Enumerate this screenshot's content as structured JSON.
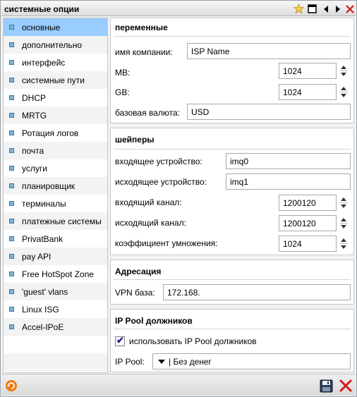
{
  "window": {
    "title": "системные опции"
  },
  "sidebar": {
    "items": [
      {
        "label": "основные"
      },
      {
        "label": "дополнительно"
      },
      {
        "label": "интерфейс"
      },
      {
        "label": "системные пути"
      },
      {
        "label": "DHCP"
      },
      {
        "label": "MRTG"
      },
      {
        "label": "Ротация логов"
      },
      {
        "label": "почта"
      },
      {
        "label": "услуги"
      },
      {
        "label": "планировщик"
      },
      {
        "label": "терминалы"
      },
      {
        "label": "платежные системы"
      },
      {
        "label": "PrivatBank"
      },
      {
        "label": "pay API"
      },
      {
        "label": "Free HotSpot Zone"
      },
      {
        "label": "'guest' vlans"
      },
      {
        "label": "Linux ISG"
      },
      {
        "label": "Accel-IPoE"
      }
    ],
    "selected": "основные"
  },
  "variables": {
    "heading": "переменные",
    "company_label": "имя компании:",
    "company_value": "ISP Name",
    "mb_label": "MB:",
    "mb_value": "1024",
    "gb_label": "GB:",
    "gb_value": "1024",
    "currency_label": "базовая валюта:",
    "currency_value": "USD"
  },
  "shapers": {
    "heading": "шейперы",
    "in_dev_label": "входящее устройство:",
    "in_dev_value": "imq0",
    "out_dev_label": "исходящее устройство:",
    "out_dev_value": "imq1",
    "in_chan_label": "входящий канал:",
    "in_chan_value": "1200120",
    "out_chan_label": "исходящий канал:",
    "out_chan_value": "1200120",
    "mult_label": "коэффициент умножения:",
    "mult_value": "1024"
  },
  "addressing": {
    "heading": "Адресация",
    "vpn_label": "VPN база:",
    "vpn_value": "172.168."
  },
  "ippool": {
    "heading": "IP Pool должников",
    "use_label": "использовать IP Pool должников",
    "use_checked": true,
    "pool_label": "IP Pool:",
    "pool_value": "| Без денег"
  },
  "icons": {
    "title_star": "star-icon",
    "title_window": "window-icon",
    "title_prev": "arrow-left-icon",
    "title_next": "arrow-right-icon",
    "title_close": "close-icon",
    "footer_refresh": "refresh-icon",
    "footer_save": "save-icon",
    "footer_cancel": "cancel-icon"
  },
  "colors": {
    "selected_bg": "#99ccff",
    "close_red": "#d11a1a",
    "refresh_orange": "#f07a10"
  }
}
